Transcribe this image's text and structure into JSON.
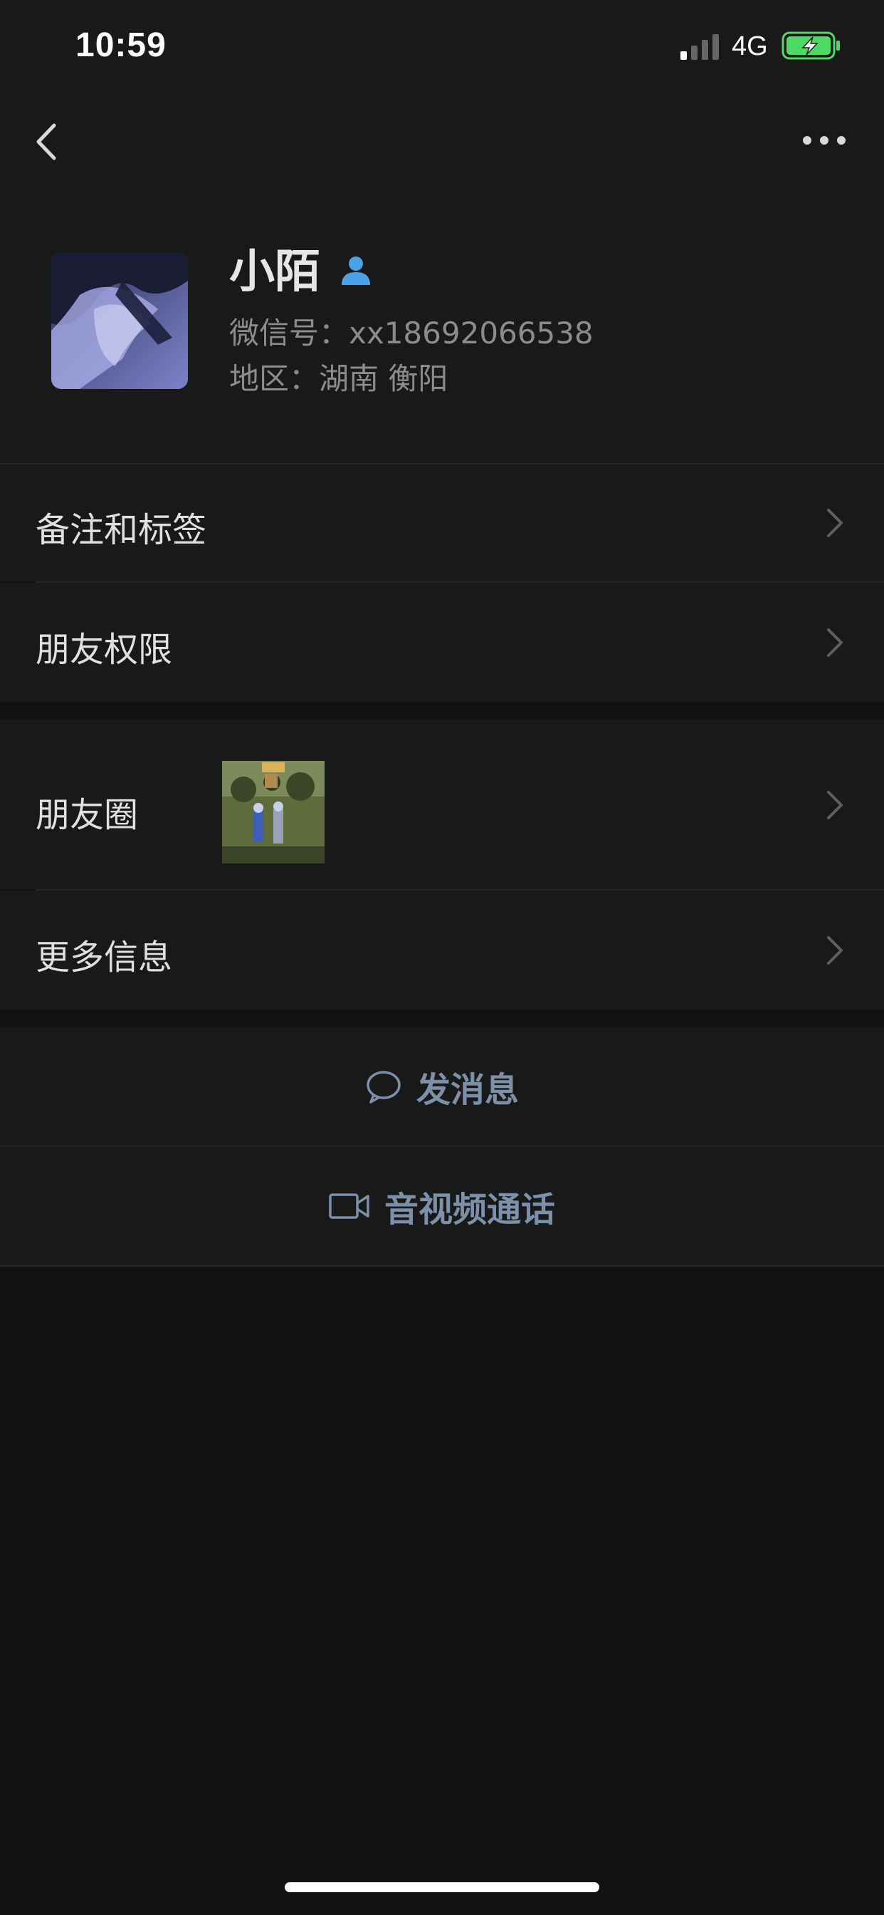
{
  "status_bar": {
    "time": "10:59",
    "network": "4G"
  },
  "nav": {
    "back_icon": "chevron-left-icon",
    "more_icon": "ellipsis-icon"
  },
  "profile": {
    "name": "小陌",
    "gender_icon": "male-user-icon",
    "wechat_id": "微信号：xx18692066538",
    "region": "地区：湖南 衡阳"
  },
  "rows": {
    "remarks_tags": "备注和标签",
    "friend_permissions": "朋友权限",
    "moments": "朋友圈",
    "more_info": "更多信息"
  },
  "actions": {
    "send_message": "发消息",
    "video_call": "音视频通话"
  },
  "colors": {
    "background": "#111111",
    "card": "#191919",
    "action_text": "#7d90a9",
    "battery_green": "#4cd964"
  }
}
